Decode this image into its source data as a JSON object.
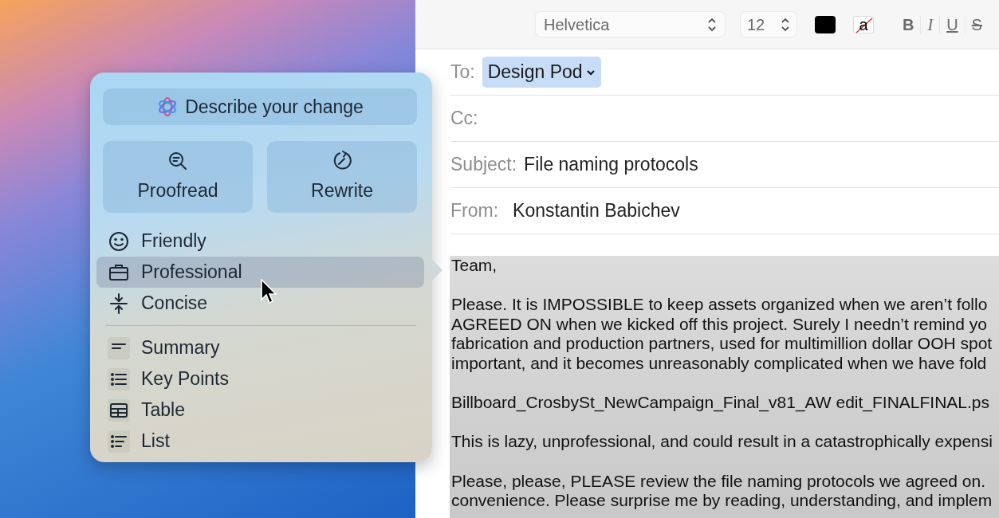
{
  "writing_tools": {
    "describe_button": {
      "label": "Describe your change"
    },
    "actions": [
      {
        "label": "Proofread"
      },
      {
        "label": "Rewrite"
      }
    ],
    "tones": [
      {
        "label": "Friendly",
        "selected": false
      },
      {
        "label": "Professional",
        "selected": true
      },
      {
        "label": "Concise",
        "selected": false
      }
    ],
    "formats": [
      {
        "label": "Summary"
      },
      {
        "label": "Key Points"
      },
      {
        "label": "Table"
      },
      {
        "label": "List"
      }
    ]
  },
  "toolbar": {
    "font": "Helvetica",
    "size": "12",
    "highlight_glyph": "a",
    "format_buttons": [
      "B",
      "I",
      "U",
      "S"
    ]
  },
  "header": {
    "to_label": "To:",
    "to_recipient": "Design Pod",
    "cc_label": "Cc:",
    "subject_label": "Subject:",
    "subject": "File naming protocols",
    "from_label": "From:",
    "from": "Konstantin Babichev"
  },
  "body": {
    "paragraphs": [
      [
        "Team,"
      ],
      [
        "Please. It is IMPOSSIBLE to keep assets organized when we aren’t follo",
        "AGREED ON when we kicked off this project. Surely I needn’t remind yo",
        "fabrication and production partners, used for multimillion dollar OOH spot",
        "important, and it becomes unreasonably complicated when we have fold"
      ],
      [
        "Billboard_CrosbySt_NewCampaign_Final_v81_AW edit_FINALFINAL.ps"
      ],
      [
        "This is lazy, unprofessional, and could result in a catastrophically expensi"
      ],
      [
        "Please, please, PLEASE review the file naming protocols we agreed on.",
        "convenience. Please surprise me by reading, understanding, and implem"
      ]
    ]
  }
}
